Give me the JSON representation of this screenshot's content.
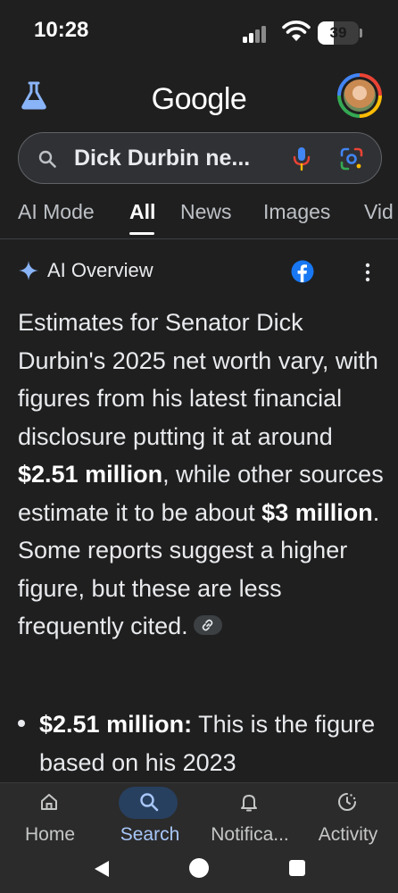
{
  "status_bar": {
    "time": "10:28",
    "battery": "39",
    "icons": [
      "signal-icon",
      "wifi-icon",
      "battery-icon"
    ]
  },
  "header": {
    "logo": "Google",
    "left_icon": "labs-flask-icon",
    "right_icon": "account-avatar"
  },
  "search": {
    "query": "Dick Durbin ne...",
    "icons": [
      "search-icon",
      "mic-icon",
      "lens-icon"
    ]
  },
  "tabs": [
    {
      "label": "AI Mode"
    },
    {
      "label": "All"
    },
    {
      "label": "News"
    },
    {
      "label": "Images"
    },
    {
      "label": "Vid"
    }
  ],
  "active_tab": "All",
  "ai_overview": {
    "title": "AI Overview",
    "p1": "Estimates for Senator Dick Durbin's 2025 net worth vary, with figures from his latest financial disclosure putting it at around ",
    "b1": "$2.51 million",
    "p2": ", while other sources estimate it to be about ",
    "b2": "$3 million",
    "p3": ". Some reports suggest a higher figure, but these are less frequently cited.",
    "bullet_bold": "$2.51 million:",
    "bullet_text": " This is the figure based on his 2023"
  },
  "colors": {
    "background": "#1f1f1f",
    "accent": "#a8c7fa",
    "sparkle": "#8ab4f8",
    "facebook": "#1877f2"
  },
  "bottom_nav": [
    {
      "label": "Home",
      "icon": "home-icon"
    },
    {
      "label": "Search",
      "icon": "search-icon"
    },
    {
      "label": "Notifica...",
      "icon": "bell-icon"
    },
    {
      "label": "Activity",
      "icon": "activity-icon"
    }
  ],
  "active_nav": "Search"
}
